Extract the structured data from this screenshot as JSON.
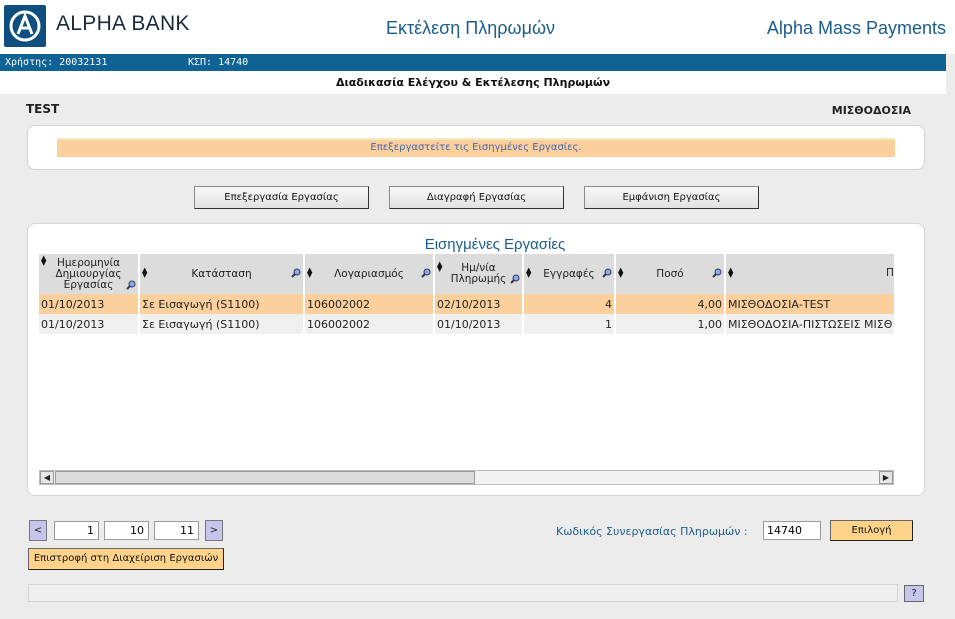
{
  "header": {
    "brand": "ALPHA BANK",
    "page_heading": "Εκτέλεση Πληρωμών",
    "app_name": "Alpha Mass Payments"
  },
  "user_bar": {
    "user": "Χρήστης: 20032131",
    "ksp": "ΚΣΠ:  14740"
  },
  "subtitle": "Διαδικασία Ελέγχου & Εκτέλεσης Πληρωμών",
  "left_label": "TEST",
  "right_label": "ΜΙΣΘΟΔΟΣΙΑ",
  "message": "Επεξεργαστείτε τις Εισηγμένες Εργασίες.",
  "buttons": {
    "edit": "Επεξεργασία Εργασίας",
    "delete": "Διαγραφή Εργασίας",
    "show": "Εμφάνιση Εργασίας"
  },
  "grid": {
    "title": "Εισηγμένες Εργασίες",
    "columns": [
      "Ημερομηνία Δημιουργίας Εργασίας",
      "Κατάσταση",
      "Λογαριασμός",
      "Ημ/νία Πληρωμής",
      "Εγγραφές",
      "Ποσό",
      "Πε"
    ],
    "rows": [
      [
        "01/10/2013",
        "Σε Εισαγωγή (S1100)",
        "106002002",
        "02/10/2013",
        "4",
        "4,00",
        "ΜΙΣΘΟΔΟΣΙΑ-TEST"
      ],
      [
        "01/10/2013",
        "Σε Εισαγωγή (S1100)",
        "106002002",
        "01/10/2013",
        "1",
        "1,00",
        "ΜΙΣΘΟΔΟΣΙΑ-ΠΙΣΤΩΣΕΙΣ ΜΙΣΘ"
      ]
    ]
  },
  "pager": {
    "prev": "<",
    "next": ">",
    "page_from": "1",
    "page_size": "10",
    "total": "11"
  },
  "cooperation": {
    "label": "Κωδικός Συνεργασίας Πληρωμών :",
    "value": "14740",
    "select": "Επιλογή"
  },
  "back_button": "Επιστροφή στη Διαχείριση Εργασιών",
  "help": "?",
  "colors": {
    "brand_blue": "#0e6294",
    "highlight": "#fbd09d",
    "accent_orange": "#ffd38a"
  }
}
